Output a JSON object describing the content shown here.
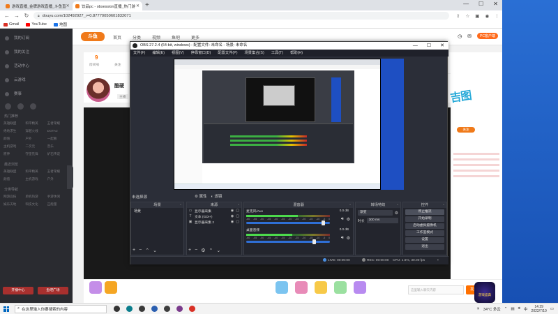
{
  "browser": {
    "tabs": [
      {
        "title": "游戏直播_金牌游戏直播_斗鱼直",
        "active": false,
        "color": "#f07a1a"
      },
      {
        "title": "饮品pc - obsession直播_热门游",
        "active": true,
        "color": "#f07a1a"
      }
    ],
    "new_tab": "+",
    "url": "douyu.com/102492927_r=0.87770050601832071",
    "bookmarks": [
      {
        "label": "Gmail",
        "color": "#d93025"
      },
      {
        "label": "YouTube",
        "color": "#ff0000"
      },
      {
        "label": "地图",
        "color": "#1a73e8"
      }
    ],
    "window_buttons": [
      "—",
      "☐",
      "✕"
    ]
  },
  "douyu": {
    "logo": "斗鱼",
    "nav": [
      "首页",
      "分类",
      "视频",
      "鱼吧",
      "更多"
    ],
    "sidebar_main": [
      "我的订阅",
      "我的关注",
      "活动中心",
      "云游戏",
      "赛事"
    ],
    "sidebar_sections": [
      {
        "head": "热门推荐",
        "items": [
          "英雄联盟",
          "和平精英",
          "王者荣耀",
          "绝地求生",
          "穿越火线",
          "DOTA2",
          "颜值",
          "户外",
          "一起看",
          "主机游戏",
          "二次元",
          "音乐",
          "原神",
          "守望先锋",
          "炉石传说"
        ]
      },
      {
        "head": "最近浏览",
        "items": [
          "英雄联盟",
          "和平精英",
          "王者荣耀",
          "颜值",
          "主机游戏",
          "户外"
        ]
      },
      {
        "head": "分类导航",
        "items": [
          "网游竞技",
          "单机热游",
          "手游休闲",
          "娱乐天地",
          "科技文化",
          "正能量"
        ]
      }
    ],
    "sidebar_buttons": [
      "开播中心",
      "鱼吧广场"
    ],
    "header_pc": "PC客户端",
    "room_number": "9",
    "room_label": "房间号",
    "follow_label": "关注",
    "anchor_name": "酷硬",
    "anchor_tag": "主播",
    "right_logo": "吉图",
    "right_btn": "关注",
    "chat_placeholder": "这里输入聊天内容",
    "send_label": "发送",
    "game_badge": "游戏盛典"
  },
  "obs": {
    "title": "OBS 27.2.4 (64-bit, windows) - 配置文件: 未命名 - 场景: 未命名",
    "window_buttons": [
      "—",
      "☐",
      "✕"
    ],
    "menu": [
      "文件(F)",
      "编辑(E)",
      "视图(V)",
      "停靠窗口(D)",
      "配置文件(P)",
      "场景集合(S)",
      "工具(T)",
      "帮助(H)"
    ],
    "no_source_label": "未选择源",
    "toolbar_props": "属性",
    "toolbar_filters": "滤镜",
    "scenes": {
      "title": "场景",
      "items": [
        "场景"
      ]
    },
    "sources": {
      "title": "来源",
      "items": [
        {
          "icon": "display-capture-icon",
          "glyph": "▭",
          "label": "显示器采集"
        },
        {
          "icon": "text-source-icon",
          "glyph": "T",
          "label": "文本 (GDI+)"
        },
        {
          "icon": "window-capture-icon",
          "glyph": "▣",
          "label": "显示器采集 2"
        }
      ]
    },
    "mixer": {
      "title": "混音器",
      "channels": [
        {
          "name": "麦克风/Aux",
          "db": "0.0 dB",
          "level": 0.62,
          "volume": 0.94
        },
        {
          "name": "桌面音频",
          "db": "0.0 dB",
          "level": 0.55,
          "volume": 0.83
        }
      ],
      "ticks": [
        "-60",
        "-55",
        "-50",
        "-45",
        "-40",
        "-35",
        "-30",
        "-25",
        "-20",
        "-15",
        "-10",
        "-5",
        "0"
      ]
    },
    "transitions": {
      "title": "转场特效",
      "selected": "渐变",
      "duration_label": "时长",
      "duration": "300 ms"
    },
    "controls": {
      "title": "控件",
      "buttons": [
        "停止推流",
        "开始录制",
        "启动虚拟摄像机",
        "工作室模式",
        "设置",
        "退出"
      ]
    },
    "status": {
      "live": "LIVE: 00:00:00",
      "rec": "REC: 00:00:00",
      "cpu": "CPU: 1.6%, 30.00 fps"
    }
  },
  "taskbar": {
    "search_placeholder": "在这里输入你要搜索的内容",
    "apps": [
      "#333333",
      "#0a7d8c",
      "#3a3a3a",
      "#2b5fb0",
      "#3d3d3d",
      "#7a3b8c",
      "#d93025"
    ],
    "weather": "34°C 多云",
    "time": "14:29",
    "date": "2022/7/10"
  }
}
